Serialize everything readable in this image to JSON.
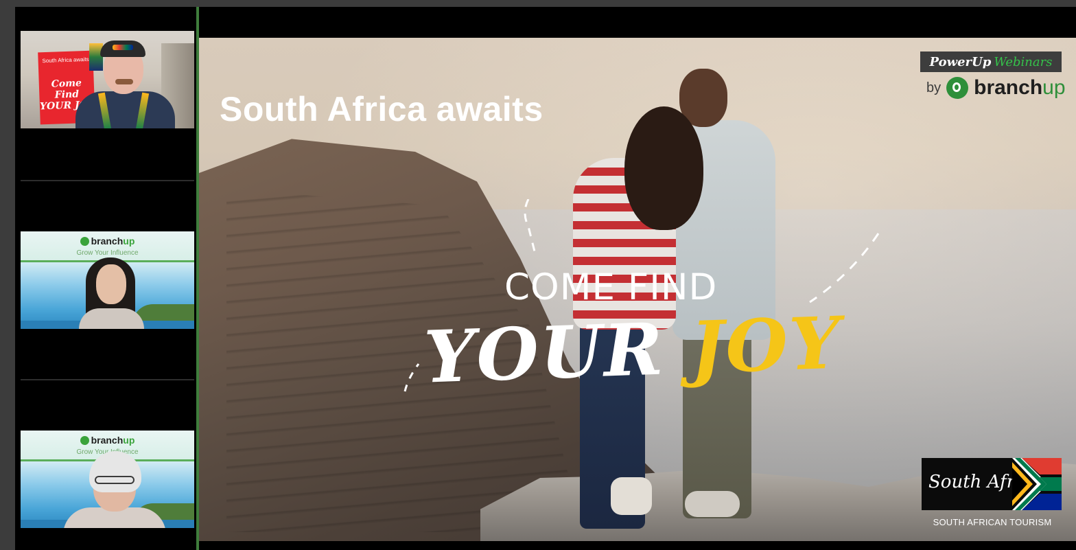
{
  "participants": [
    {
      "name": "participant-1",
      "background": "office"
    },
    {
      "name": "participant-2",
      "background": "branchup",
      "logo": "branchup",
      "tagline": "Grow Your Influence"
    },
    {
      "name": "participant-3",
      "background": "branchup",
      "logo": "branchup",
      "tagline": "Grow Your Influence"
    }
  ],
  "slide": {
    "headline": "South Africa awaits",
    "tagline_line1": "COME FIND",
    "tagline_your": "YOUR",
    "tagline_joy": "JOY",
    "poster_small": "South Africa awaits",
    "poster_line1": "Come Find",
    "poster_line2": "YOUR JOY"
  },
  "branding": {
    "powerup_part1": "PowerUp",
    "powerup_part2": "Webinars",
    "by": "by",
    "branch": "branch",
    "up": "up",
    "sa_logo_text": "South Africa",
    "sa_tourism": "SOUTH AFRICAN TOURISM"
  },
  "colors": {
    "accent_green": "#3f7d3c",
    "joy_yellow": "#f5c518",
    "branchup_green": "#2e8f3a"
  }
}
